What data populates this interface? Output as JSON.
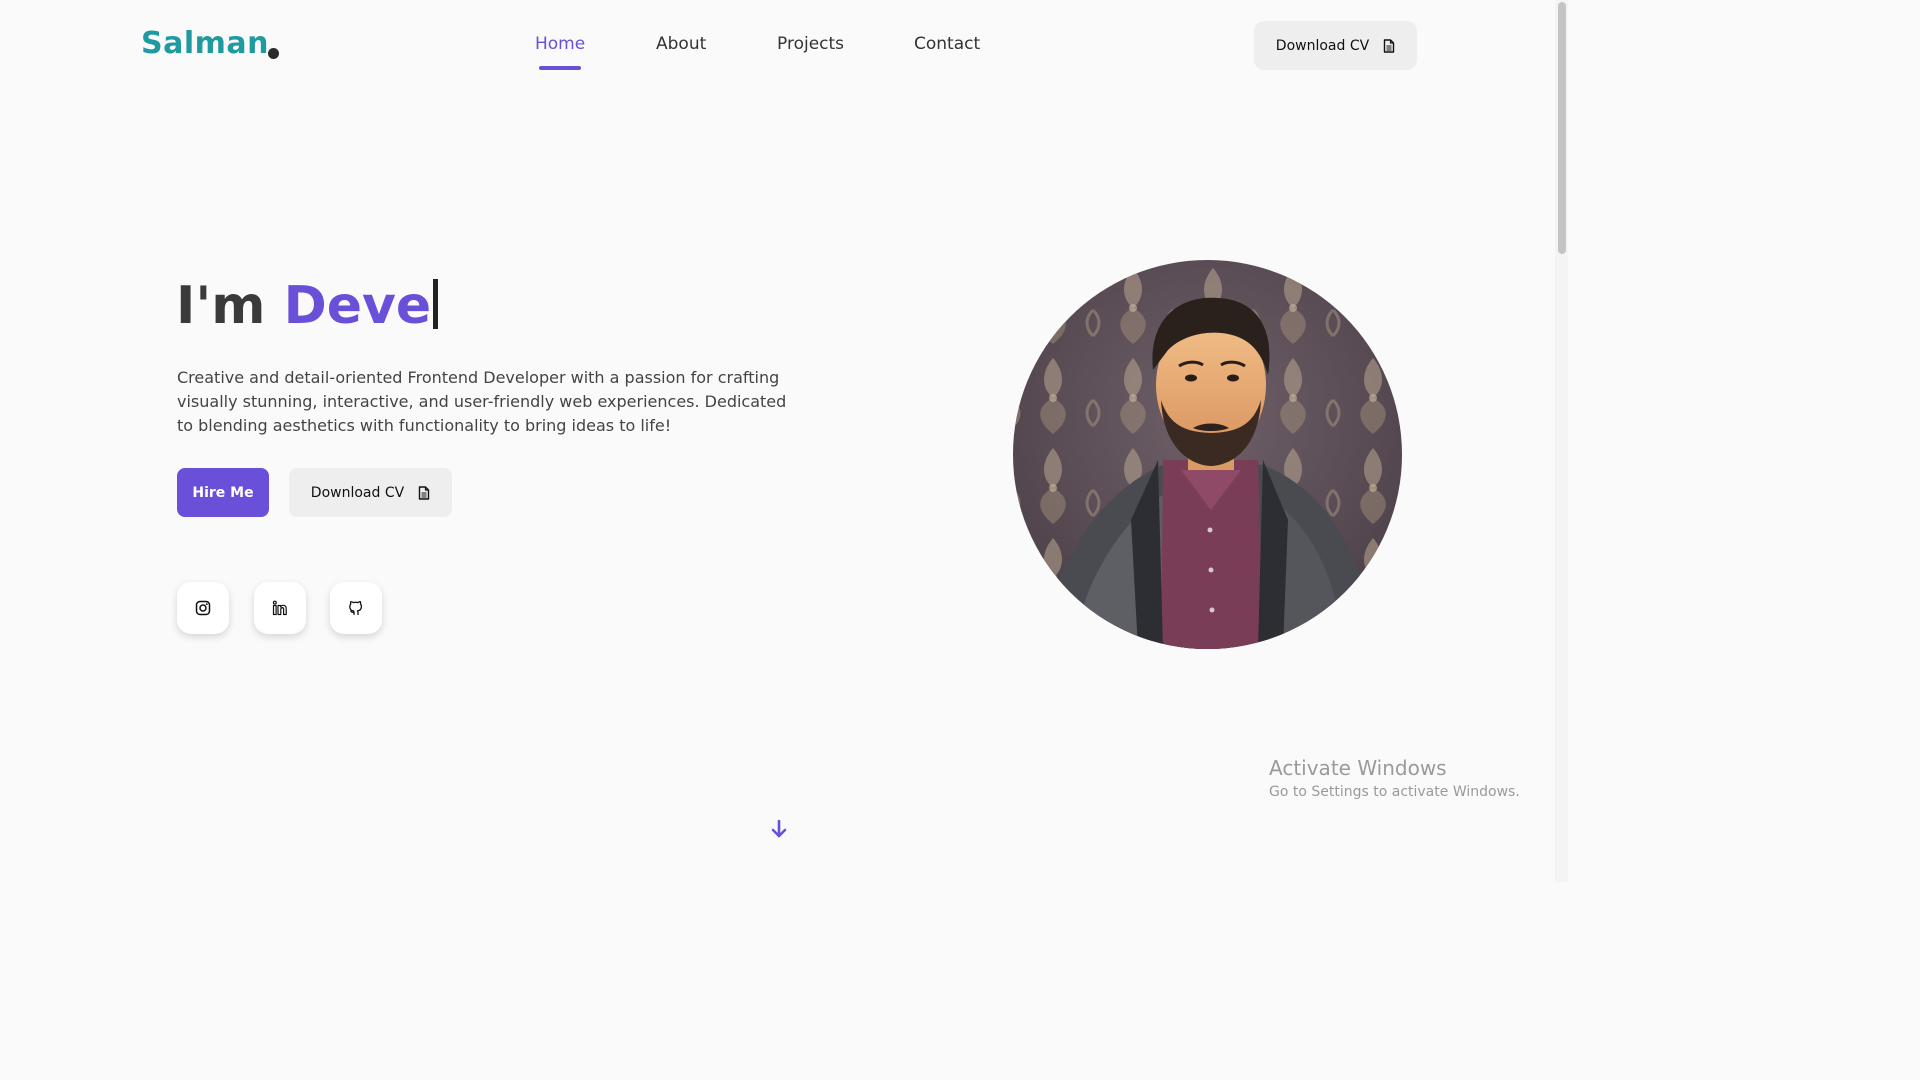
{
  "header": {
    "logo": "Salman",
    "nav": [
      {
        "label": "Home",
        "active": true
      },
      {
        "label": "About",
        "active": false
      },
      {
        "label": "Projects",
        "active": false
      },
      {
        "label": "Contact",
        "active": false
      }
    ],
    "download_cv_label": "Download CV"
  },
  "hero": {
    "title_prefix": "I'm ",
    "title_typed": "Deve",
    "description": "Creative and detail-oriented Frontend Developer with a passion for crafting visually stunning, interactive, and user-friendly web experiences. Dedicated to blending aesthetics with functionality to bring ideas to life!",
    "hire_label": "Hire Me",
    "download_cv_label": "Download CV"
  },
  "social": [
    {
      "icon": "instagram-icon"
    },
    {
      "icon": "linkedin-icon"
    },
    {
      "icon": "github-icon"
    }
  ],
  "watermark": {
    "title": "Activate Windows",
    "subtitle": "Go to Settings to activate Windows."
  },
  "colors": {
    "accent": "#6a4fd8",
    "logo": "#1e9aa0",
    "background": "#fafafa"
  }
}
